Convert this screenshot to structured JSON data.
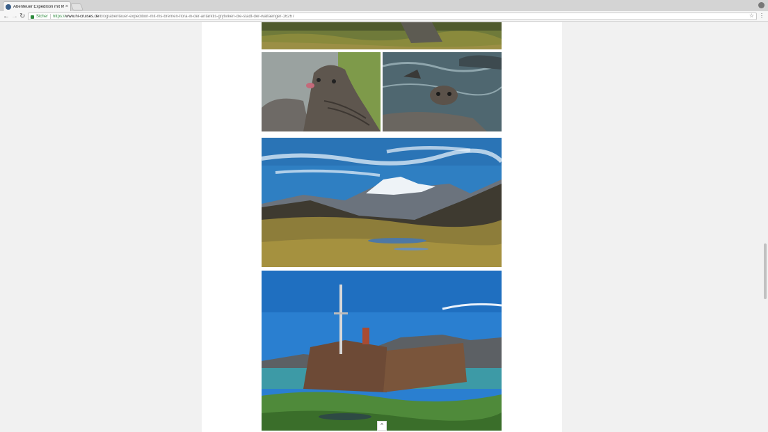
{
  "browser": {
    "tab_title": "Abenteuer Expedition mit MS",
    "tab_close": "×",
    "secure_label": "Sicher",
    "url_scheme": "https://",
    "url_host": "www.hl-cruises.de",
    "url_path": "/blog/abenteuer-expedition-mit-ms-bremen-flora-in-der-antarktis-grytviken-die-stadt-der-walfaenger-16267"
  },
  "icons": {
    "back": "back-arrow-icon",
    "forward": "forward-arrow-icon",
    "reload": "reload-icon",
    "lock": "lock-icon",
    "star": "bookmark-star-icon",
    "menu": "kebab-menu-icon",
    "profile": "profile-icon",
    "back_to_top": "double-chevron-up-icon"
  },
  "colors": {
    "secure_green": "#2e8b3e",
    "page_background": "#f1f1f1",
    "content_background": "#ffffff"
  }
}
